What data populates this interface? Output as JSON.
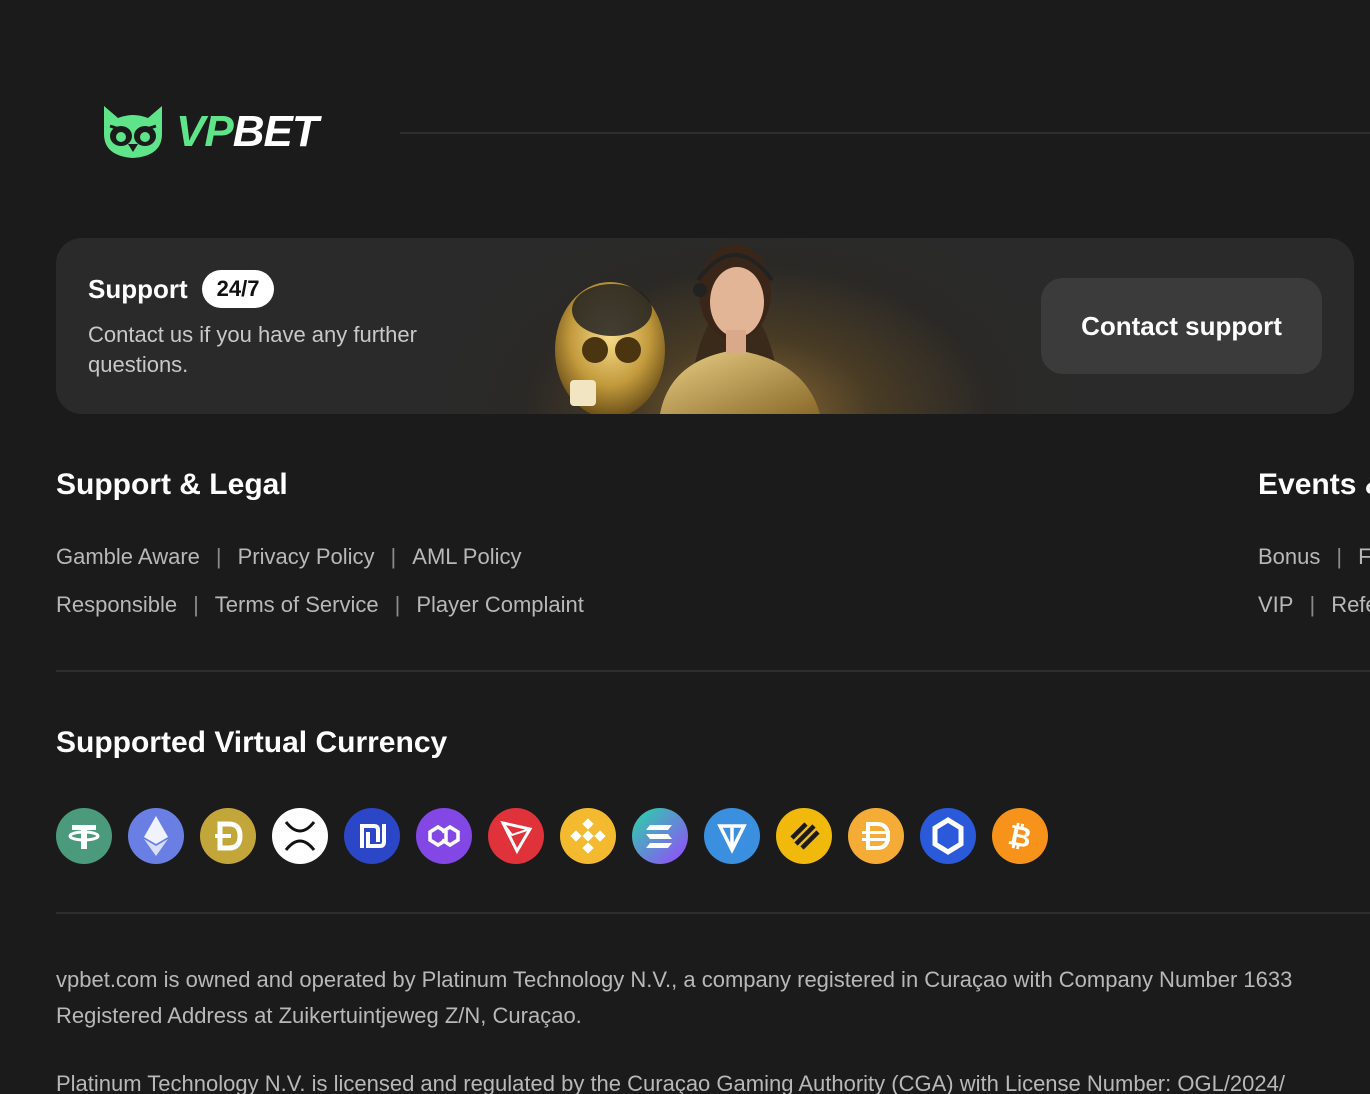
{
  "header": {
    "logo_vp": "VP",
    "logo_bet": "BET"
  },
  "support": {
    "title": "Support",
    "badge": "24/7",
    "description": "Contact us if you have any further questions.",
    "button": "Contact support"
  },
  "support_legal": {
    "title": "Support & Legal",
    "row1": [
      "Gamble Aware",
      "Privacy Policy",
      "AML Policy"
    ],
    "row2": [
      "Responsible",
      "Terms of Service",
      "Player Complaint"
    ]
  },
  "events": {
    "title": "Events &",
    "row1": [
      "Bonus",
      "F"
    ],
    "row2": [
      "VIP",
      "Refe"
    ]
  },
  "currency": {
    "title": "Supported Virtual Currency",
    "coins": [
      {
        "icon": "tether-icon",
        "color": "#4a9a7b"
      },
      {
        "icon": "ethereum-icon",
        "color": "#6a7fe3"
      },
      {
        "icon": "dogecoin-icon",
        "color": "#c3a63a"
      },
      {
        "icon": "xrp-icon",
        "color": "#ffffff"
      },
      {
        "icon": "shekel-icon",
        "color": "#2b46c6"
      },
      {
        "icon": "polygon-icon",
        "color": "#8247e5"
      },
      {
        "icon": "tron-icon",
        "color": "#e0323a"
      },
      {
        "icon": "binance-icon",
        "color": "#f3ba2f"
      },
      {
        "icon": "solana-icon",
        "color": "#9b5fd4"
      },
      {
        "icon": "ton-icon",
        "color": "#3a8fdf"
      },
      {
        "icon": "busd-icon",
        "color": "#f0b90b"
      },
      {
        "icon": "dai-icon",
        "color": "#f5ac37"
      },
      {
        "icon": "chainlink-icon",
        "color": "#2a5ada"
      },
      {
        "icon": "bitcoin-icon",
        "color": "#f7931a"
      }
    ]
  },
  "legal": {
    "line1": "vpbet.com is owned and operated by Platinum Technology N.V., a company registered in Curaçao with Company Number 1633",
    "line2": "Registered Address at Zuikertuintjeweg Z/N, Curaçao.",
    "line3": "Platinum Technology N.V. is licensed and regulated by the Curaçao Gaming Authority (CGA) with License Number: OGL/2024/"
  }
}
